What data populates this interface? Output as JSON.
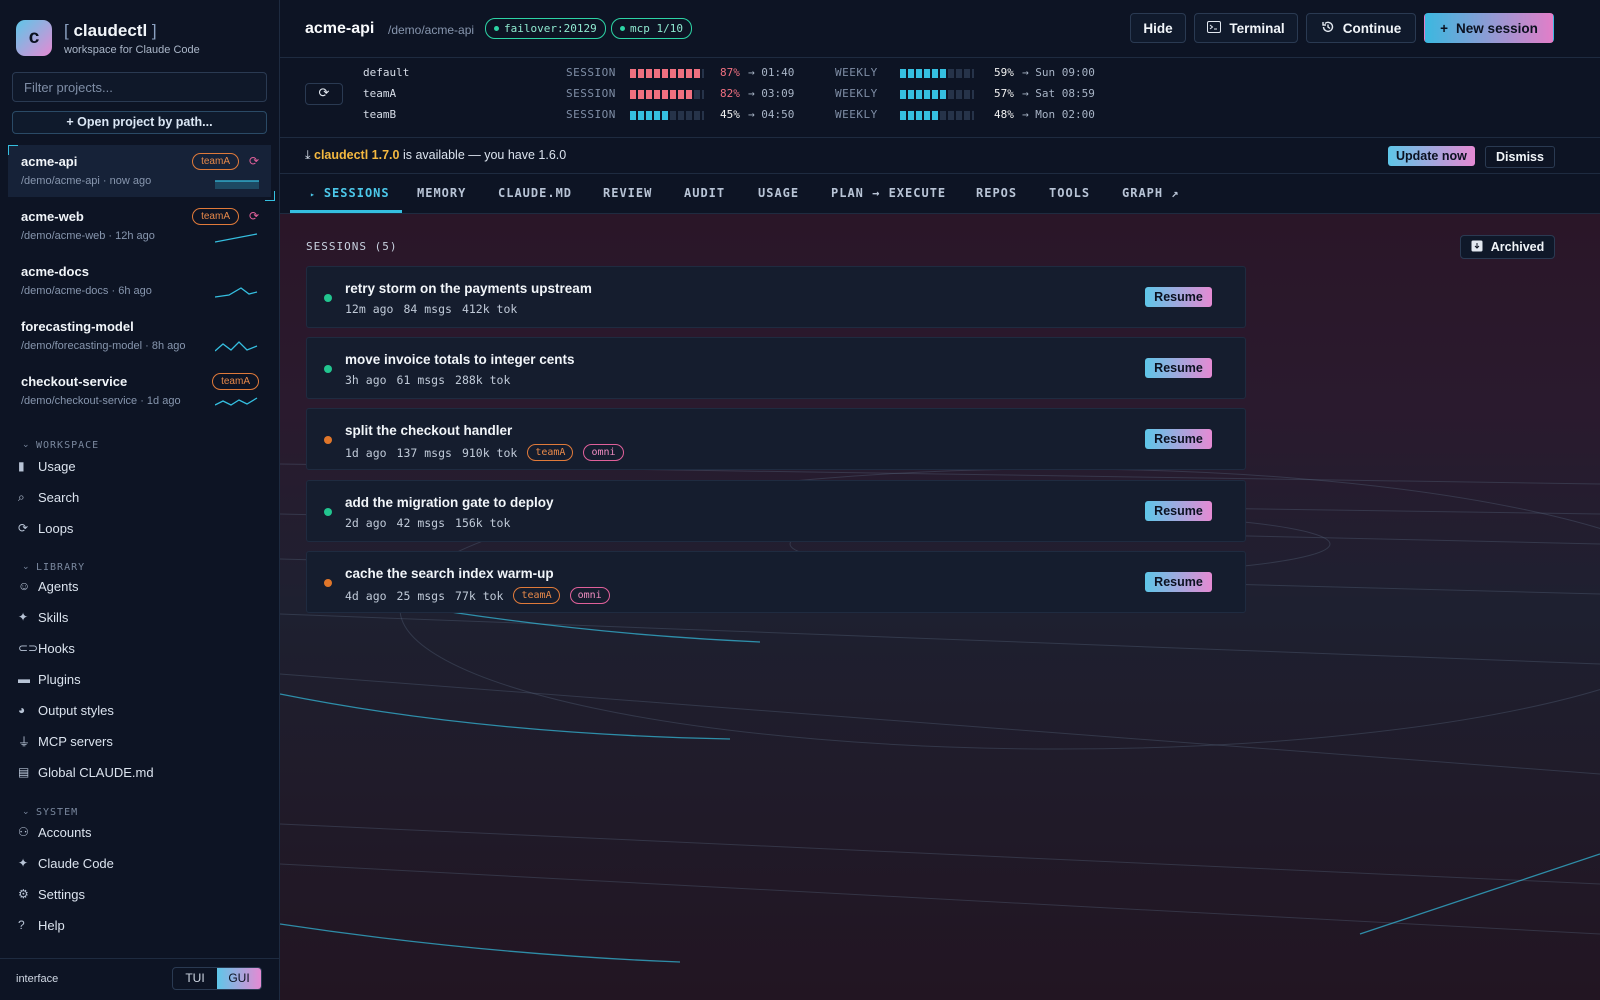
{
  "brand": {
    "logo_letter": "c",
    "bracket_open": "[",
    "name": "claudectl",
    "bracket_close": "]",
    "subtitle": "workspace for Claude Code"
  },
  "filter": {
    "placeholder": "Filter projects..."
  },
  "open_project_label": "+ Open project by path...",
  "projects": [
    {
      "name": "acme-api",
      "path": "/demo/acme-api · now ago",
      "tag": "teamA",
      "refresh": true
    },
    {
      "name": "acme-web",
      "path": "/demo/acme-web · 12h ago",
      "tag": "teamA",
      "refresh": true
    },
    {
      "name": "acme-docs",
      "path": "/demo/acme-docs · 6h ago",
      "tag": "",
      "refresh": false
    },
    {
      "name": "forecasting-model",
      "path": "/demo/forecasting-model · 8h ago",
      "tag": "",
      "refresh": false
    },
    {
      "name": "checkout-service",
      "path": "/demo/checkout-service · 1d ago",
      "tag": "teamA",
      "refresh": false
    }
  ],
  "sidebar": {
    "workspace_label": "WORKSPACE",
    "workspace": [
      {
        "label": "Usage",
        "icon": "bar-chart-icon"
      },
      {
        "label": "Search",
        "icon": "search-icon"
      },
      {
        "label": "Loops",
        "icon": "loop-icon"
      }
    ],
    "library_label": "LIBRARY",
    "library": [
      {
        "label": "Agents",
        "icon": "robot-icon"
      },
      {
        "label": "Skills",
        "icon": "sparkle-icon"
      },
      {
        "label": "Hooks",
        "icon": "link-icon"
      },
      {
        "label": "Plugins",
        "icon": "folder-icon"
      },
      {
        "label": "Output styles",
        "icon": "palette-icon"
      },
      {
        "label": "MCP servers",
        "icon": "plug-icon"
      },
      {
        "label": "Global CLAUDE.md",
        "icon": "document-icon"
      }
    ],
    "system_label": "SYSTEM",
    "system": [
      {
        "label": "Accounts",
        "icon": "people-icon"
      },
      {
        "label": "Claude Code",
        "icon": "sparkle-icon"
      },
      {
        "label": "Settings",
        "icon": "gear-icon"
      },
      {
        "label": "Help",
        "icon": "help-icon"
      }
    ],
    "interface_label": "interface",
    "interface_options": [
      "TUI",
      "GUI"
    ],
    "interface_selected": "GUI"
  },
  "header": {
    "title": "acme-api",
    "path": "/demo/acme-api",
    "badge_failover": "failover:20129",
    "badge_mcp": "mcp 1/10",
    "hide_label": "Hide",
    "terminal_label": "Terminal",
    "continue_label": "Continue",
    "new_session_label": "New session"
  },
  "usage": [
    {
      "account": "default",
      "session_label": "SESSION",
      "session_pct": 87,
      "session_pct_text": "87%",
      "session_reset": "→ 01:40",
      "weekly_label": "WEEKLY",
      "weekly_pct": 59,
      "weekly_pct_text": "59%",
      "weekly_reset": "→ Sun 09:00"
    },
    {
      "account": "teamA",
      "session_label": "SESSION",
      "session_pct": 82,
      "session_pct_text": "82%",
      "session_reset": "→ 03:09",
      "weekly_label": "WEEKLY",
      "weekly_pct": 57,
      "weekly_pct_text": "57%",
      "weekly_reset": "→ Sat 08:59"
    },
    {
      "account": "teamB",
      "session_label": "SESSION",
      "session_pct": 45,
      "session_pct_text": "45%",
      "session_reset": "→ 04:50",
      "weekly_label": "WEEKLY",
      "weekly_pct": 48,
      "weekly_pct_text": "48%",
      "weekly_reset": "→ Mon 02:00"
    }
  ],
  "update": {
    "product": "claudectl 1.7.0",
    "message": " is available — you have 1.6.0",
    "update_label": "Update now",
    "dismiss_label": "Dismiss"
  },
  "tabs": [
    "SESSIONS",
    "MEMORY",
    "CLAUDE.MD",
    "REVIEW",
    "AUDIT",
    "USAGE",
    "PLAN → EXECUTE",
    "REPOS",
    "TOOLS",
    "GRAPH"
  ],
  "active_tab": "SESSIONS",
  "sessions_title": "SESSIONS (5)",
  "archived_label": "Archived",
  "sessions": [
    {
      "title": "retry storm on the payments upstream",
      "age": "12m ago",
      "msgs": "84 msgs",
      "tok": "412k tok",
      "tags": [],
      "status_color": "#22c58f",
      "resume_label": "Resume"
    },
    {
      "title": "move invoice totals to integer cents",
      "age": "3h ago",
      "msgs": "61 msgs",
      "tok": "288k tok",
      "tags": [],
      "status_color": "#22c58f",
      "resume_label": "Resume"
    },
    {
      "title": "split the checkout handler",
      "age": "1d ago",
      "msgs": "137 msgs",
      "tok": "910k tok",
      "tags": [
        "teamA",
        "omni"
      ],
      "status_color": "#e0762a",
      "resume_label": "Resume"
    },
    {
      "title": "add the migration gate to deploy",
      "age": "2d ago",
      "msgs": "42 msgs",
      "tok": "156k tok",
      "tags": [],
      "status_color": "#22c58f",
      "resume_label": "Resume"
    },
    {
      "title": "cache the search index warm-up",
      "age": "4d ago",
      "msgs": "25 msgs",
      "tok": "77k tok",
      "tags": [
        "teamA",
        "omni"
      ],
      "status_color": "#e0762a",
      "resume_label": "Resume"
    }
  ],
  "colors": {
    "accent": "#35bfe0",
    "pink": "#e58ad3",
    "session_bar": "#f07080",
    "weekly_bar": "#35bfe0",
    "bar_empty": "#263349"
  }
}
